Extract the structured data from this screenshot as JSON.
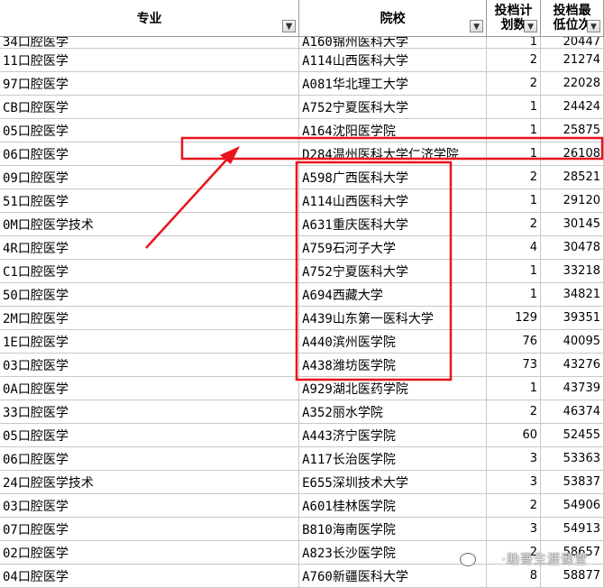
{
  "headers": {
    "major": "专业",
    "school": "院校",
    "plan_line1": "投档计",
    "plan_line2": "划数",
    "rank_line1": "投档最",
    "rank_line2": "低位次"
  },
  "rows": [
    {
      "major": "34口腔医学",
      "school": "A160锦州医科大学",
      "plan": "1",
      "rank": "20447"
    },
    {
      "major": "11口腔医学",
      "school": "A114山西医科大学",
      "plan": "2",
      "rank": "21274"
    },
    {
      "major": "97口腔医学",
      "school": "A081华北理工大学",
      "plan": "2",
      "rank": "22028"
    },
    {
      "major": "CB口腔医学",
      "school": "A752宁夏医科大学",
      "plan": "1",
      "rank": "24424"
    },
    {
      "major": "05口腔医学",
      "school": "A164沈阳医学院",
      "plan": "1",
      "rank": "25875"
    },
    {
      "major": "06口腔医学",
      "school": "D284温州医科大学仁济学院",
      "plan": "1",
      "rank": "26108"
    },
    {
      "major": "09口腔医学",
      "school": "A598广西医科大学",
      "plan": "2",
      "rank": "28521"
    },
    {
      "major": "51口腔医学",
      "school": "A114山西医科大学",
      "plan": "1",
      "rank": "29120"
    },
    {
      "major": "0M口腔医学技术",
      "school": "A631重庆医科大学",
      "plan": "2",
      "rank": "30145"
    },
    {
      "major": "4R口腔医学",
      "school": "A759石河子大学",
      "plan": "4",
      "rank": "30478"
    },
    {
      "major": "C1口腔医学",
      "school": "A752宁夏医科大学",
      "plan": "1",
      "rank": "33218"
    },
    {
      "major": "50口腔医学",
      "school": "A694西藏大学",
      "plan": "1",
      "rank": "34821"
    },
    {
      "major": "2M口腔医学",
      "school": "A439山东第一医科大学",
      "plan": "129",
      "rank": "39351"
    },
    {
      "major": "1E口腔医学",
      "school": "A440滨州医学院",
      "plan": "76",
      "rank": "40095"
    },
    {
      "major": "03口腔医学",
      "school": "A438潍坊医学院",
      "plan": "73",
      "rank": "43276"
    },
    {
      "major": "0A口腔医学",
      "school": "A929湖北医药学院",
      "plan": "1",
      "rank": "43739"
    },
    {
      "major": "33口腔医学",
      "school": "A352丽水学院",
      "plan": "2",
      "rank": "46374"
    },
    {
      "major": "05口腔医学",
      "school": "A443济宁医学院",
      "plan": "60",
      "rank": "52455"
    },
    {
      "major": "06口腔医学",
      "school": "A117长治医学院",
      "plan": "3",
      "rank": "53363"
    },
    {
      "major": "24口腔医学技术",
      "school": "E655深圳技术大学",
      "plan": "3",
      "rank": "53837"
    },
    {
      "major": "03口腔医学",
      "school": "A601桂林医学院",
      "plan": "2",
      "rank": "54906"
    },
    {
      "major": "07口腔医学",
      "school": "B810海南医学院",
      "plan": "3",
      "rank": "54913"
    },
    {
      "major": "02口腔医学",
      "school": "A823长沙医学院",
      "plan": "2",
      "rank": "58657"
    },
    {
      "major": "04口腔医学",
      "school": "A760新疆医科大学",
      "plan": "8",
      "rank": "58877"
    }
  ],
  "icons": {
    "filter_active": "filter-active-icon",
    "filter": "dropdown-filter-icon"
  },
  "colors": {
    "highlight": "#e8141c",
    "grid": "#c8c8c8"
  },
  "watermark": "·助哥生涯课堂"
}
